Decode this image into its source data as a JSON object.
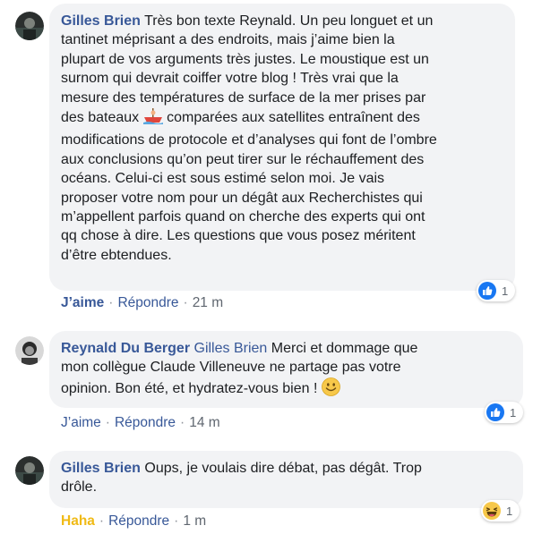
{
  "comments": [
    {
      "author": "Gilles Brien",
      "text_lines": [
        "Très bon texte Reynald. Un peu longuet et un",
        "tantinet méprisant a des endroits, mais j’aime bien la",
        "plupart de vos arguments très justes. Le moustique est un",
        "surnom qui devrait coiffer votre blog ! Très vrai que la",
        "mesure des températures de surface de la mer prises par",
        "des bateaux",
        "comparées aux satellites entraînent des",
        "modifications de protocole et d’analyses qui font de l’ombre",
        "aux conclusions qu’on peut tirer sur le réchauffement des",
        "océans. Celui-ci est sous estimé selon moi. Je vais",
        "proposer votre nom pour un dégât aux Recherchistes qui",
        "m’appellent parfois quand on cherche des experts qui ont",
        "qq chose à dire. Les questions que vous posez méritent",
        "d’être ebtendues."
      ],
      "emoji": "rowboat-emoji",
      "actions": {
        "like": "J’aime",
        "reply": "Répondre",
        "time": "21 m"
      },
      "reaction": {
        "icon": "like-icon",
        "count": "1"
      }
    },
    {
      "author": "Reynald Du Berger",
      "mention": "Gilles Brien",
      "text_lines": [
        "Merci et dommage que",
        "mon collègue Claude Villeneuve ne partage pas votre",
        "opinion. Bon été, et hydratez-vous bien !"
      ],
      "emoji": "smile-emoji",
      "actions": {
        "like": "J’aime",
        "reply": "Répondre",
        "time": "14 m"
      },
      "reaction": {
        "icon": "like-icon",
        "count": "1"
      }
    },
    {
      "author": "Gilles Brien",
      "text_lines": [
        "Oups, je voulais dire débat, pas dégât. Trop",
        "drôle."
      ],
      "actions": {
        "like": "Haha",
        "reply": "Répondre",
        "time": "1 m"
      },
      "reaction": {
        "icon": "haha-icon",
        "count": "1"
      }
    }
  ],
  "separator": "·",
  "colors": {
    "author": "#385898",
    "bubble": "#f2f3f5",
    "like_blue": "#1877f2",
    "haha_yellow": "#f0ba15"
  }
}
